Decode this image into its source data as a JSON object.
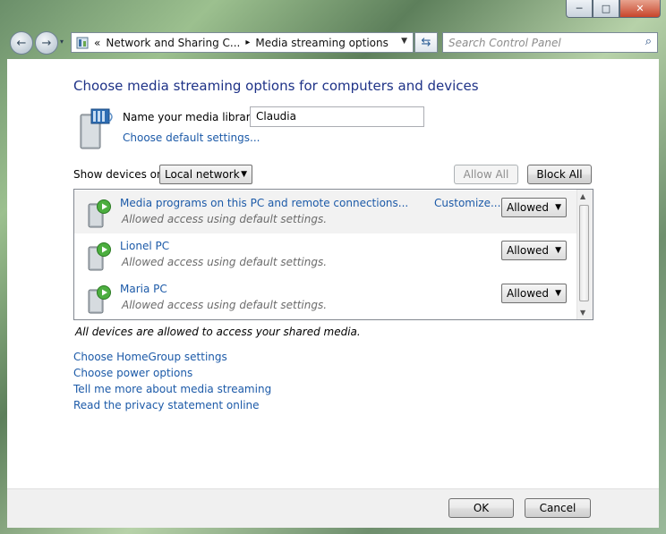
{
  "window": {
    "caption": {
      "minimize": "─",
      "maximize": "□",
      "close": "✕"
    }
  },
  "nav": {
    "back_icon": "←",
    "forward_icon": "→",
    "breadcrumb": [
      "«",
      "Network and Sharing C...",
      "▸",
      "Media streaming options"
    ],
    "search_placeholder": "Search Control Panel"
  },
  "content": {
    "title": "Choose media streaming options for computers and devices",
    "library_label": "Name your media library:",
    "library_name": "Claudia",
    "default_settings_link": "Choose default settings...",
    "show_devices_label": "Show devices on:",
    "show_devices_value": "Local network",
    "allow_all": "Allow All",
    "block_all": "Block All",
    "devices": [
      {
        "name": "Media programs on this PC and remote connections...",
        "status": "Allowed access using default settings.",
        "customize": "Customize...",
        "access": "Allowed"
      },
      {
        "name": "Lionel PC",
        "status": "Allowed access using default settings.",
        "access": "Allowed"
      },
      {
        "name": "Maria PC",
        "status": "Allowed access using default settings.",
        "access": "Allowed"
      }
    ],
    "note": "All devices are allowed to access your shared media.",
    "links": [
      "Choose HomeGroup settings",
      "Choose power options",
      "Tell me more about media streaming",
      "Read the privacy statement online"
    ]
  },
  "footer": {
    "ok": "OK",
    "cancel": "Cancel"
  },
  "colors": {
    "link": "#1c5aa8",
    "title": "#1e3287"
  }
}
